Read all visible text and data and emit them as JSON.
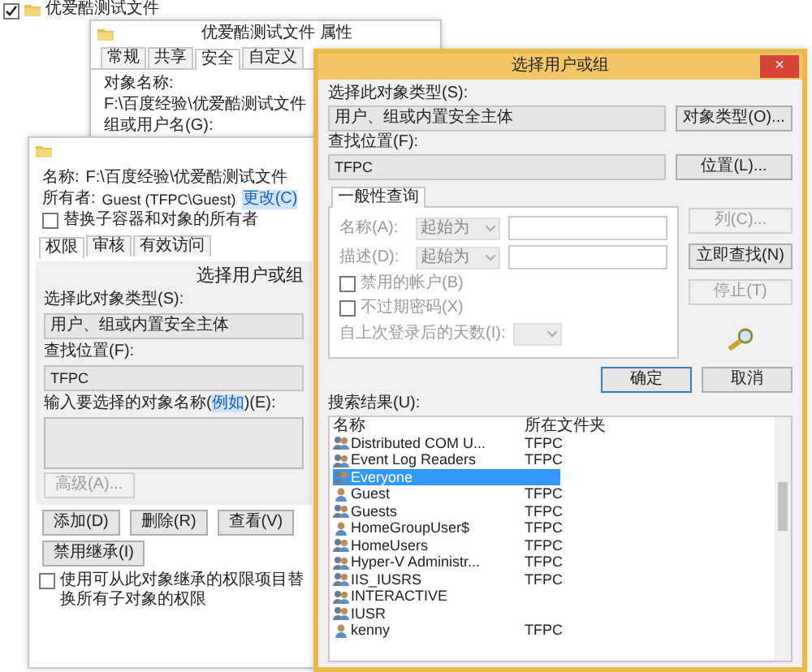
{
  "explorer_row": {
    "checked": true,
    "name": "优爱酷测试文件"
  },
  "properties_window": {
    "title": "优爱酷测试文件 属性",
    "tabs": [
      {
        "label": "常规",
        "selected": false
      },
      {
        "label": "共享",
        "selected": false
      },
      {
        "label": "安全",
        "selected": true
      },
      {
        "label": "自定义",
        "selected": false
      }
    ],
    "object_name_label": "对象名称:",
    "object_name": "F:\\百度经验\\优爱酷测试文件",
    "group_label": "组或用户名(G):"
  },
  "security_window": {
    "name_label": "名称:",
    "name": "F:\\百度经验\\优爱酷测试文件",
    "owner_label": "所有者:",
    "owner": "Guest (TFPC\\Guest)",
    "owner_link": "更改(C)",
    "replace_owner": {
      "label": "替换子容器和对象的所有者",
      "checked": false
    },
    "tabs": [
      {
        "label": "权限",
        "selected": true
      },
      {
        "label": "审核",
        "selected": false
      },
      {
        "label": "有效访问",
        "selected": false
      }
    ],
    "embedded_dialog": {
      "title": "选择用户或组",
      "object_type_label": "选择此对象类型(S):",
      "object_type": "用户、组或内置安全主体",
      "location_label": "查找位置(F):",
      "location": "TFPC",
      "names_label": "输入要选择的对象名称(",
      "names_link": "例如",
      "names_label_end": ")(E):",
      "advanced_button": {
        "label": "高级(A)...",
        "disabled": true
      }
    },
    "buttons": [
      {
        "label": "添加(D)",
        "disabled": false
      },
      {
        "label": "删除(R)",
        "disabled": false
      },
      {
        "label": "查看(V)",
        "disabled": false
      }
    ],
    "disable_inheritance": "禁用继承(I)",
    "replace_child": {
      "label": "使用可从此对象继承的权限项目替换所有子对象的权限",
      "checked": false
    }
  },
  "select_dialog": {
    "title": "选择用户或组",
    "close": "×",
    "object_type_label": "选择此对象类型(S):",
    "object_type": "用户、组或内置安全主体",
    "object_type_button": "对象类型(O)...",
    "location_label": "查找位置(F):",
    "location": "TFPC",
    "location_button": "位置(L)...",
    "query_tab": {
      "label": "一般性查询",
      "selected": true
    },
    "query_fields": [
      {
        "label": "名称(A):",
        "mode": "起始为"
      },
      {
        "label": "描述(D):",
        "mode": "起始为"
      }
    ],
    "query_checks": [
      {
        "label": "禁用的帐户(B)",
        "checked": false
      },
      {
        "label": "不过期密码(X)",
        "checked": false
      }
    ],
    "days_label": "自上次登录后的天数(I):",
    "side_buttons": [
      {
        "label": "列(C)...",
        "disabled": true
      },
      {
        "label": "立即查找(N)",
        "disabled": false
      },
      {
        "label": "停止(T)",
        "disabled": true
      }
    ],
    "ok": "确定",
    "cancel": "取消",
    "results_label": "搜索结果(U):",
    "columns": [
      "名称",
      "所在文件夹"
    ],
    "results": [
      {
        "name": "Distributed COM U...",
        "folder": "TFPC",
        "kind": "group",
        "selected": false
      },
      {
        "name": "Event Log Readers",
        "folder": "TFPC",
        "kind": "group",
        "selected": false
      },
      {
        "name": "Everyone",
        "kind": "group",
        "selected": true
      },
      {
        "name": "Guest",
        "folder": "TFPC",
        "kind": "user",
        "selected": false
      },
      {
        "name": "Guests",
        "folder": "TFPC",
        "kind": "group",
        "selected": false
      },
      {
        "name": "HomeGroupUser$",
        "folder": "TFPC",
        "kind": "user",
        "selected": false
      },
      {
        "name": "HomeUsers",
        "folder": "TFPC",
        "kind": "group",
        "selected": false
      },
      {
        "name": "Hyper-V Administr...",
        "folder": "TFPC",
        "kind": "group",
        "selected": false
      },
      {
        "name": "IIS_IUSRS",
        "folder": "TFPC",
        "kind": "group",
        "selected": false
      },
      {
        "name": "INTERACTIVE",
        "kind": "group",
        "selected": false
      },
      {
        "name": "IUSR",
        "kind": "group",
        "selected": false
      },
      {
        "name": "kenny",
        "folder": "TFPC",
        "kind": "user",
        "selected": false
      }
    ]
  }
}
